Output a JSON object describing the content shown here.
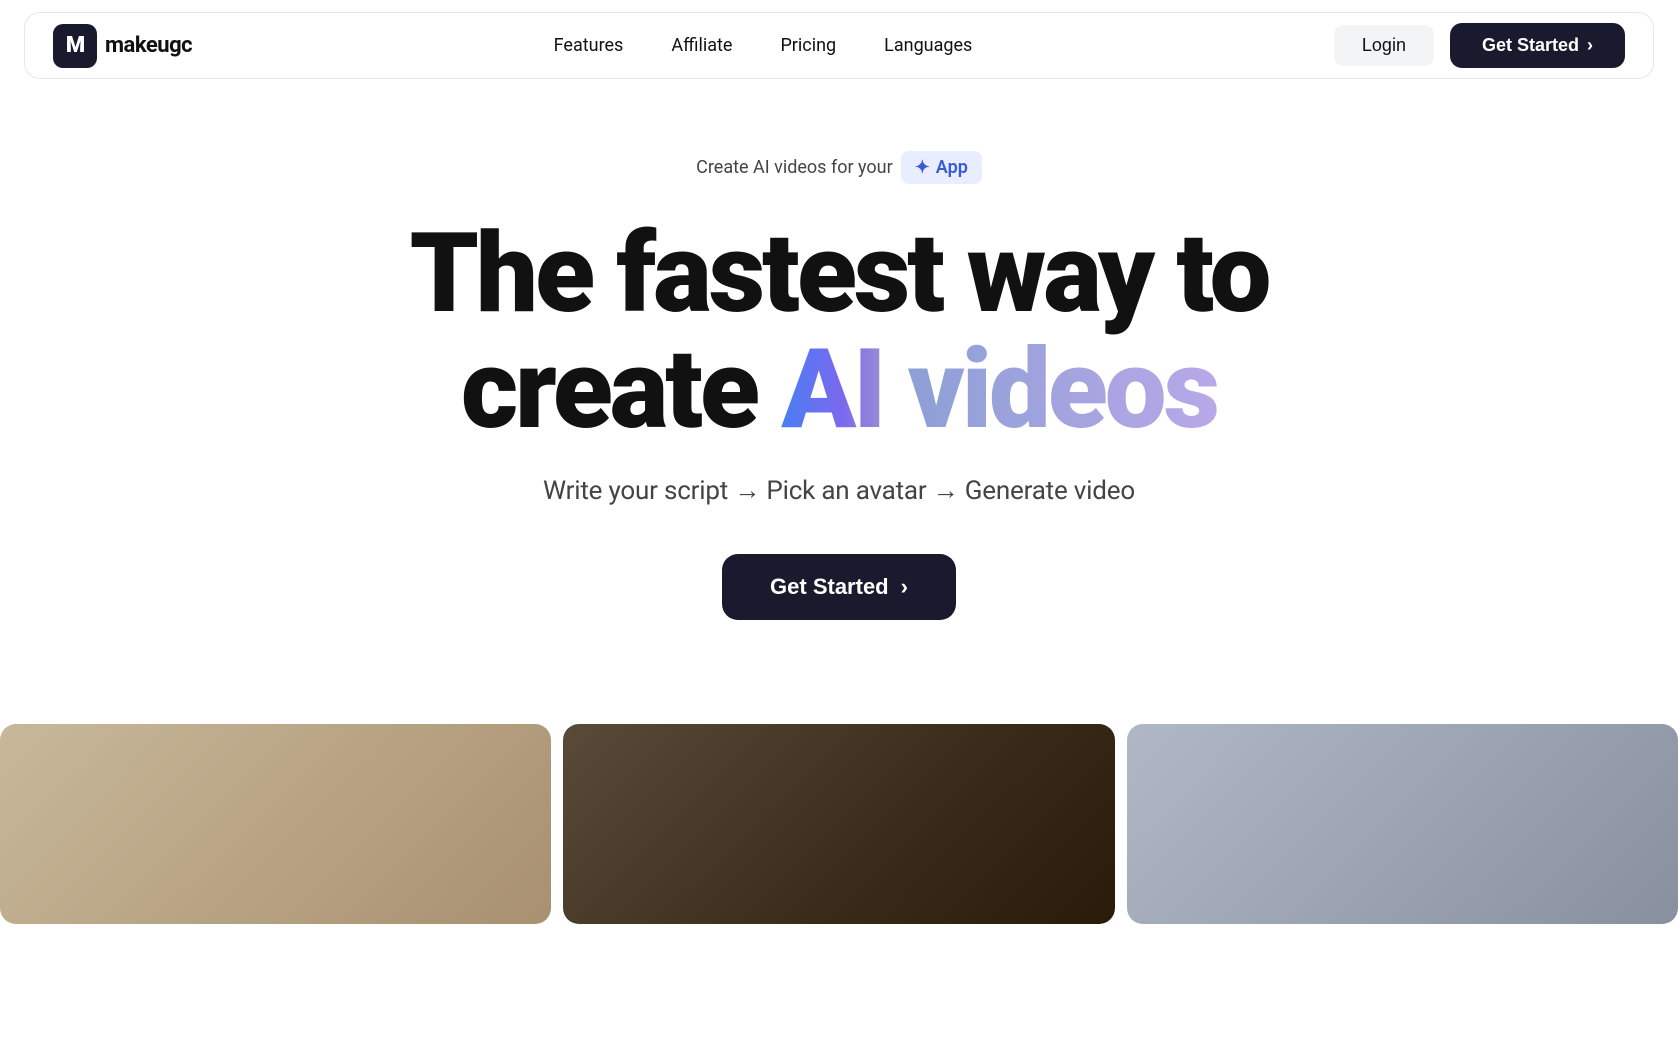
{
  "nav": {
    "logo_letter": "M",
    "logo_name": "makeugc",
    "links": [
      {
        "label": "Features",
        "id": "features"
      },
      {
        "label": "Affiliate",
        "id": "affiliate"
      },
      {
        "label": "Pricing",
        "id": "pricing"
      },
      {
        "label": "Languages",
        "id": "languages"
      }
    ],
    "login_label": "Login",
    "get_started_label": "Get Started",
    "chevron": "›"
  },
  "hero": {
    "tag_prefix": "Create AI videos for your",
    "tag_badge_icon": "✦",
    "tag_badge_label": "App",
    "title_line1": "The fastest way to",
    "title_line2_plain": "create ",
    "title_line2_ai": "AI",
    "title_line2_videos": " videos",
    "subtitle": "Write your script → Pick an avatar → Generate video",
    "cta_label": "Get Started",
    "chevron": "›"
  },
  "video_strip": {
    "cards": [
      {
        "id": "card-1",
        "color_start": "#c8b89a",
        "color_end": "#a89070"
      },
      {
        "id": "card-2",
        "color_start": "#5a4a3a",
        "color_end": "#2a1a0a"
      },
      {
        "id": "card-3",
        "color_start": "#b0b8c8",
        "color_end": "#8890a0"
      }
    ]
  }
}
